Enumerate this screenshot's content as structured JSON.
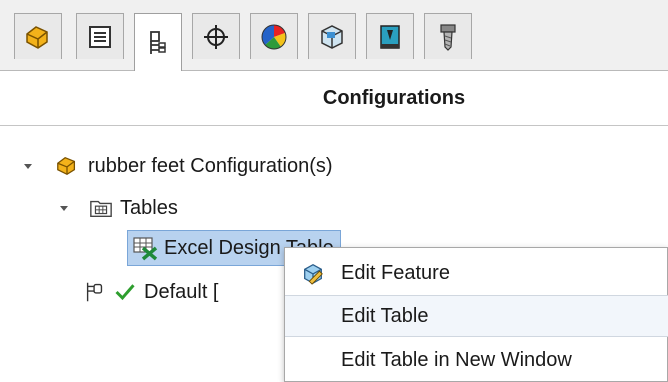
{
  "tabs": [
    {
      "icon": "feature-manager-icon"
    },
    {
      "icon": "property-manager-icon"
    },
    {
      "icon": "configuration-manager-icon",
      "active": true
    },
    {
      "icon": "dimxpert-manager-icon"
    },
    {
      "icon": "display-manager-icon"
    },
    {
      "icon": "cam-feature-tree-icon"
    },
    {
      "icon": "cam-operation-tree-icon"
    },
    {
      "icon": "cam-tool-tree-icon"
    }
  ],
  "panel": {
    "title": "Configurations"
  },
  "tree": {
    "root_label": "rubber feet Configuration(s)",
    "tables_label": "Tables",
    "design_table_label": "Excel Design Table",
    "default_label": "Default ["
  },
  "context_menu": {
    "items": [
      {
        "label": "Edit Feature",
        "icon": "edit-feature-icon"
      },
      {
        "label": "Edit Table"
      },
      {
        "label": "Edit Table in New Window"
      }
    ]
  },
  "colors": {
    "selection": "#b8d2ef",
    "accent_check": "#2e9e2e",
    "part_icon": "#e8a500"
  }
}
